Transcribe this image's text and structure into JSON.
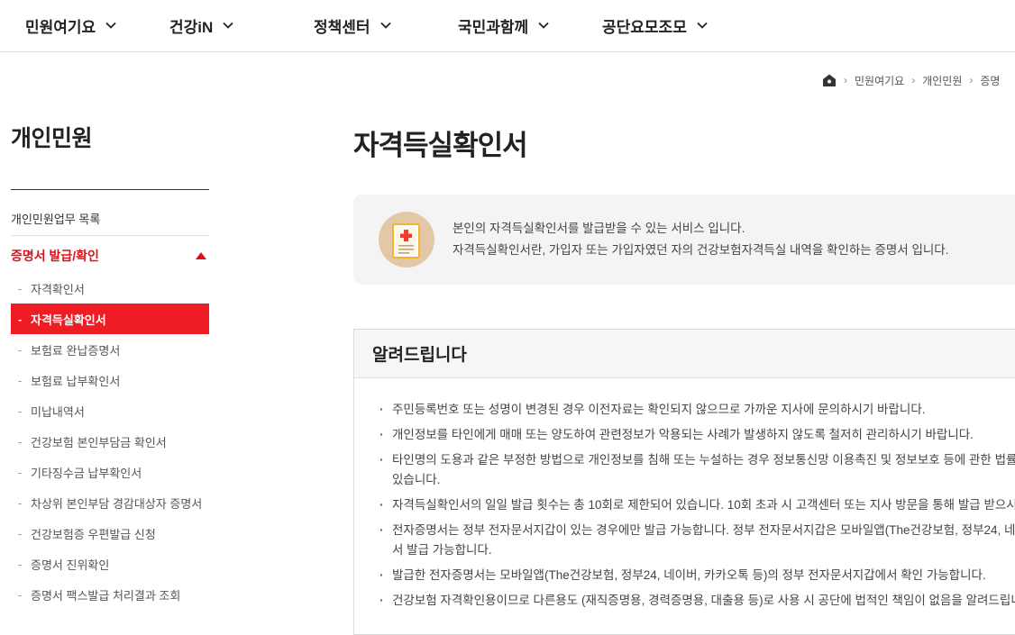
{
  "gnb": {
    "items": [
      {
        "label": "민원여기요"
      },
      {
        "label": "건강iN"
      },
      {
        "label": "정책센터"
      },
      {
        "label": "국민과함께"
      },
      {
        "label": "공단요모조모"
      }
    ]
  },
  "breadcrumb": {
    "items": [
      "민원여기요",
      "개인민원",
      "증명"
    ]
  },
  "lnb": {
    "title": "개인민원",
    "top_item": "개인민원업무 목록",
    "group_label": "증명서 발급/확인",
    "sub_items": [
      {
        "label": "자격확인서"
      },
      {
        "label": "자격득실확인서"
      },
      {
        "label": "보험료 완납증명서"
      },
      {
        "label": "보험료 납부확인서"
      },
      {
        "label": "미납내역서"
      },
      {
        "label": "건강보험 본인부담금 확인서"
      },
      {
        "label": "기타징수금 납부확인서"
      },
      {
        "label": "차상위 본인부담 경감대상자 증명서"
      },
      {
        "label": "건강보험증 우편발급 신청"
      },
      {
        "label": "증명서 진위확인"
      },
      {
        "label": "증명서 팩스발급 처리결과 조회"
      }
    ]
  },
  "main": {
    "title": "자격득실확인서",
    "intro": {
      "line1": "본인의 자격득실확인서를 발급받을 수 있는 서비스 입니다.",
      "line2": "자격득실확인서란, 가입자 또는 가입자였던 자의 건강보험자격득실 내역을 확인하는 증명서 입니다."
    },
    "notice": {
      "title": "알려드립니다",
      "items": [
        "주민등록번호 또는 성명이 변경된 경우 이전자료는 확인되지 않으므로 가까운 지사에 문의하시기 바랍니다.",
        "개인정보를 타인에게 매매 또는 양도하여 관련정보가 악용되는 사례가 발생하지 않도록 철저히 관리하시기 바랍니다.",
        "타인명의 도용과 같은 부정한 방법으로 개인정보를 침해 또는 누설하는 경우 정보통신망 이용촉진 및 정보보호 등에 관한 법률",
        "있습니다.",
        "자격득실확인서의 일일 발급 횟수는 총 10회로 제한되어 있습니다. 10회 초과 시 고객센터 또는 지사 방문을 통해 발급 받으시",
        "전자증명서는 정부 전자문서지갑이 있는 경우에만 발급 가능합니다. 정부 전자문서지갑은 모바일앱(The건강보험, 정부24, 네",
        "서 발급 가능합니다.",
        "발급한 전자증명서는 모바일앱(The건강보험, 정부24, 네이버, 카카오톡 등)의 정부 전자문서지갑에서 확인 가능합니다.",
        "건강보험 자격확인용이므로 다른용도 (재직증명용, 경력증명용, 대출용 등)로 사용 시 공단에 법적인 책임이 없음을 알려드립니"
      ]
    }
  },
  "colors": {
    "accent": "#ee1c23",
    "accent_text": "#d8131b",
    "panel_bg": "#f4f4f4"
  },
  "icons": {
    "gnb_chevron": "chevron-down-icon",
    "home": "home-icon",
    "breadcrumb_sep": "chevron-right-icon",
    "group_toggle": "triangle-up-icon",
    "intro": "certificate-icon"
  }
}
